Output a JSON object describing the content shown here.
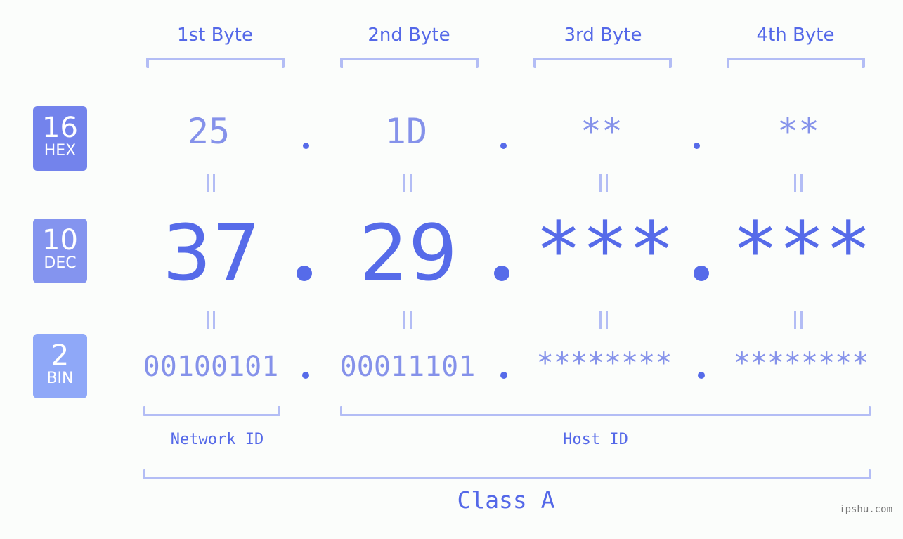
{
  "byte_headers": [
    "1st Byte",
    "2nd Byte",
    "3rd Byte",
    "4th Byte"
  ],
  "badges": {
    "hex": {
      "number": "16",
      "label": "HEX",
      "color": "#7383ec"
    },
    "dec": {
      "number": "10",
      "label": "DEC",
      "color": "#8494ef"
    },
    "bin": {
      "number": "2",
      "label": "BIN",
      "color": "#8fa8f8"
    }
  },
  "hex_values": [
    "25",
    "1D",
    "**",
    "**"
  ],
  "dec_values": [
    "37",
    "29",
    "***",
    "***"
  ],
  "bin_values": [
    "00100101",
    "00011101",
    "********",
    "********"
  ],
  "equals_symbol": "=",
  "network_id_label": "Network ID",
  "host_id_label": "Host ID",
  "class_label": "Class A",
  "watermark": "ipshu.com",
  "colors": {
    "accent": "#566be9",
    "light_accent": "#8592ea",
    "bracket": "#b3bdf5",
    "background": "#fbfdfb"
  }
}
